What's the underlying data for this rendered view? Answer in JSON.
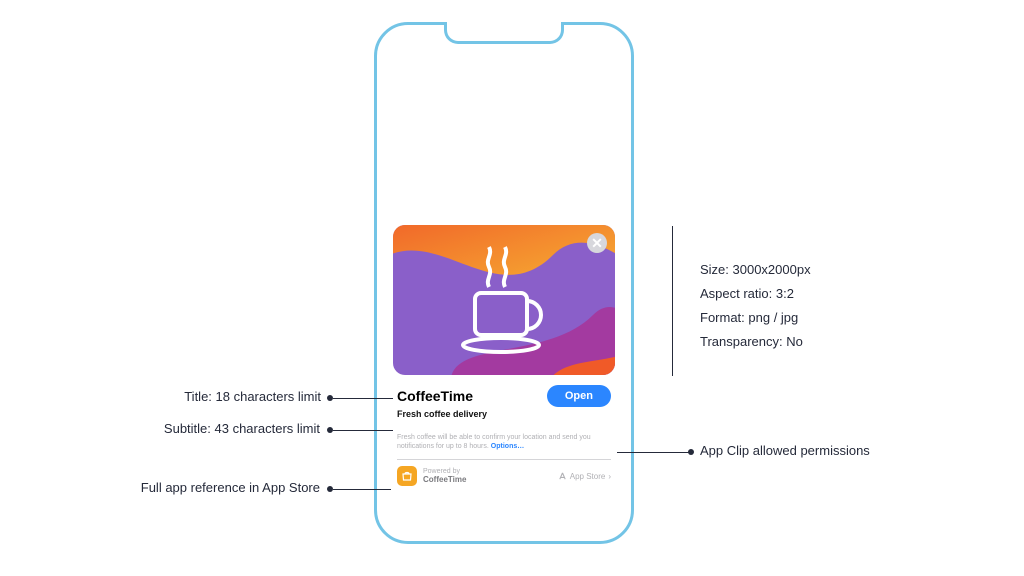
{
  "card": {
    "title": "CoffeeTime",
    "subtitle": "Fresh coffee delivery",
    "open_label": "Open",
    "permission_text": "Fresh coffee will be able to confirm your location and send you notifications for up to 8 hours.",
    "options_label": "Options…",
    "powered_label": "Powered by",
    "powered_name": "CoffeeTime",
    "appstore_label": "App Store"
  },
  "annotations": {
    "title": "Title: 18 characters limit",
    "subtitle": "Subtitle: 43 characters limit",
    "footer": "Full app reference in App Store",
    "permissions": "App Clip allowed permissions",
    "specs": {
      "size": "Size: 3000x2000px",
      "ratio": "Aspect ratio: 3:2",
      "format": "Format: png / jpg",
      "transparency": "Transparency: No"
    }
  }
}
